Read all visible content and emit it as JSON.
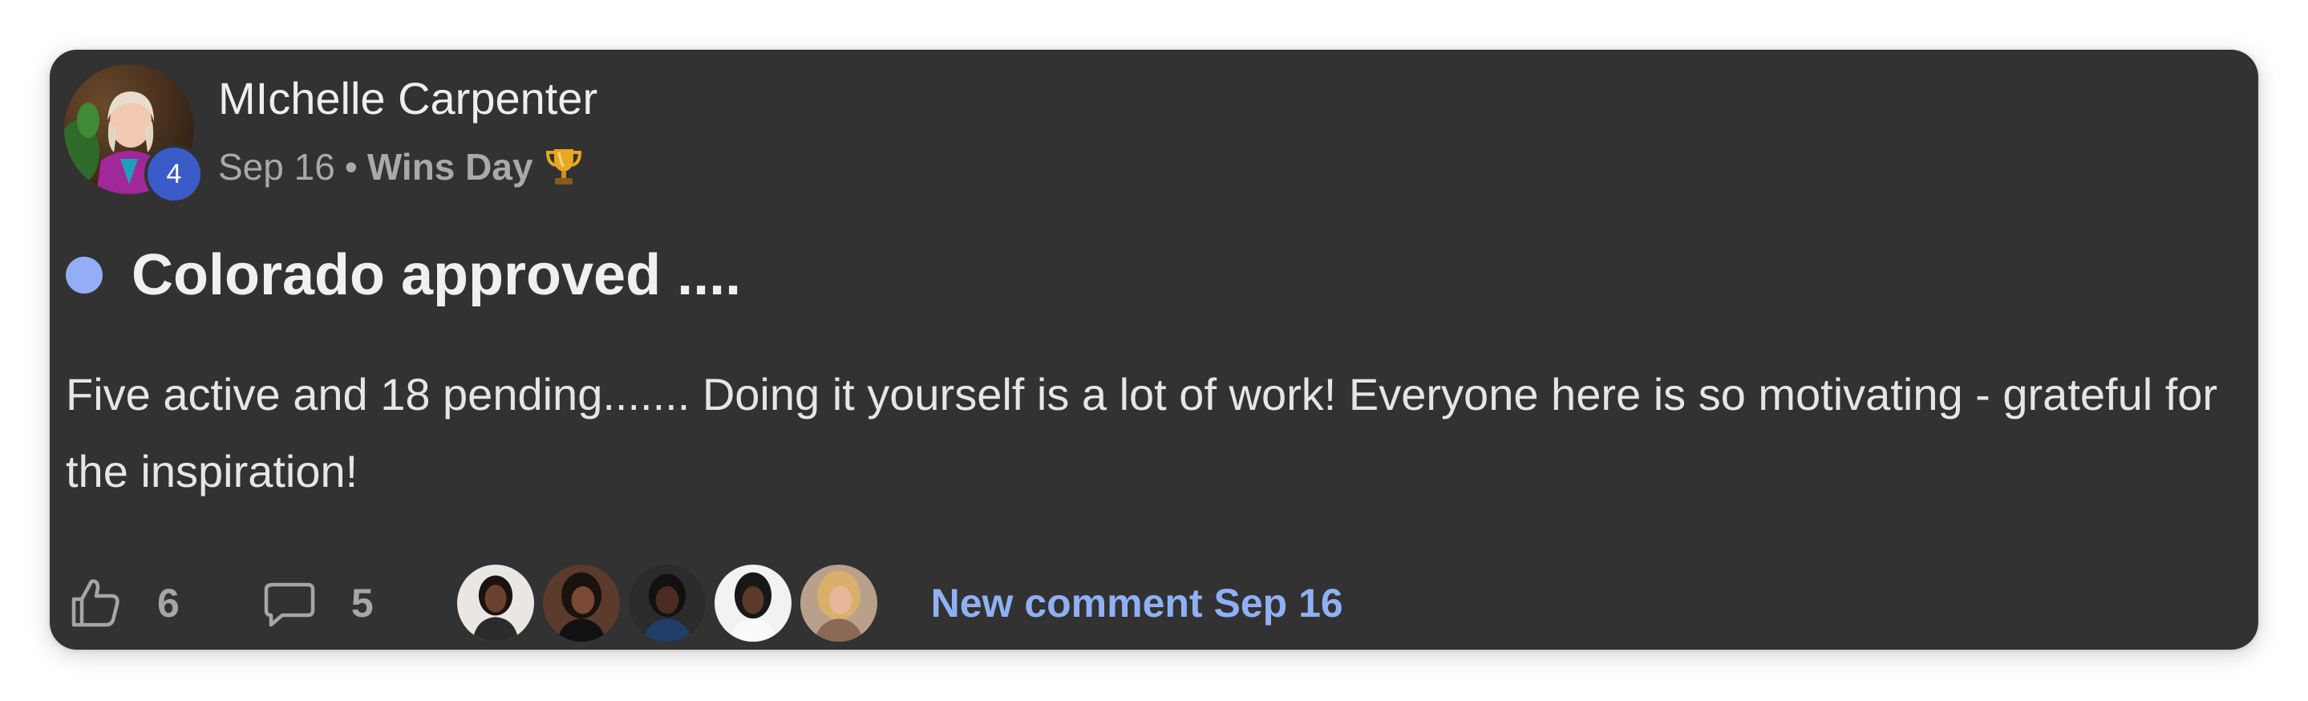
{
  "post": {
    "author": "MIchelle Carpenter",
    "level": "4",
    "date": "Sep 16",
    "separator": "•",
    "category": "Wins Day",
    "category_icon": "trophy-icon",
    "title": "Colorado approved ....",
    "body": "Five active and 18 pending....... Doing it yourself is a lot of work! Everyone here is so motivating - grateful for the inspiration!",
    "likes": "6",
    "comments": "5",
    "new_comment": "New comment Sep 16",
    "commenter_count": 5
  },
  "colors": {
    "card_bg": "#323232",
    "accent_blue": "#8fb0f4",
    "unread_dot": "#93aef5",
    "level_badge": "#3b5bc9",
    "muted": "#a9a9a9"
  }
}
